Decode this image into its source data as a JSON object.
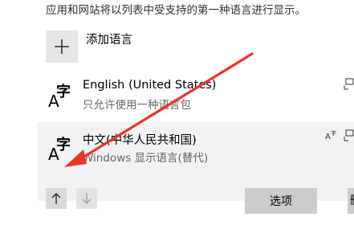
{
  "page": {
    "description": "应用和网站将以列表中受支持的第一种语言进行显示。"
  },
  "add_language": {
    "label": "添加语言",
    "icon": "plus-icon"
  },
  "languages": [
    {
      "name": "English (United States)",
      "subtitle": "只允许使用一种语言包",
      "icon_big": "A",
      "icon_small": "字",
      "feature_icons": [
        "keyboard-icon"
      ]
    },
    {
      "name": "中文(中华人民共和国)",
      "subtitle": "Windows 显示语言(替代)",
      "icon_big": "A",
      "icon_small": "字",
      "feature_icons": [
        "display-language-icon",
        "keyboard-icon"
      ],
      "selected": true
    }
  ],
  "selected_actions": {
    "move_up_icon": "arrow-up-icon",
    "move_down_icon": "arrow-down-icon",
    "options_label": "选项",
    "remove_label": "删"
  },
  "annotation": {
    "color": "#e8362c",
    "icon": "red-arrow-annotation"
  }
}
